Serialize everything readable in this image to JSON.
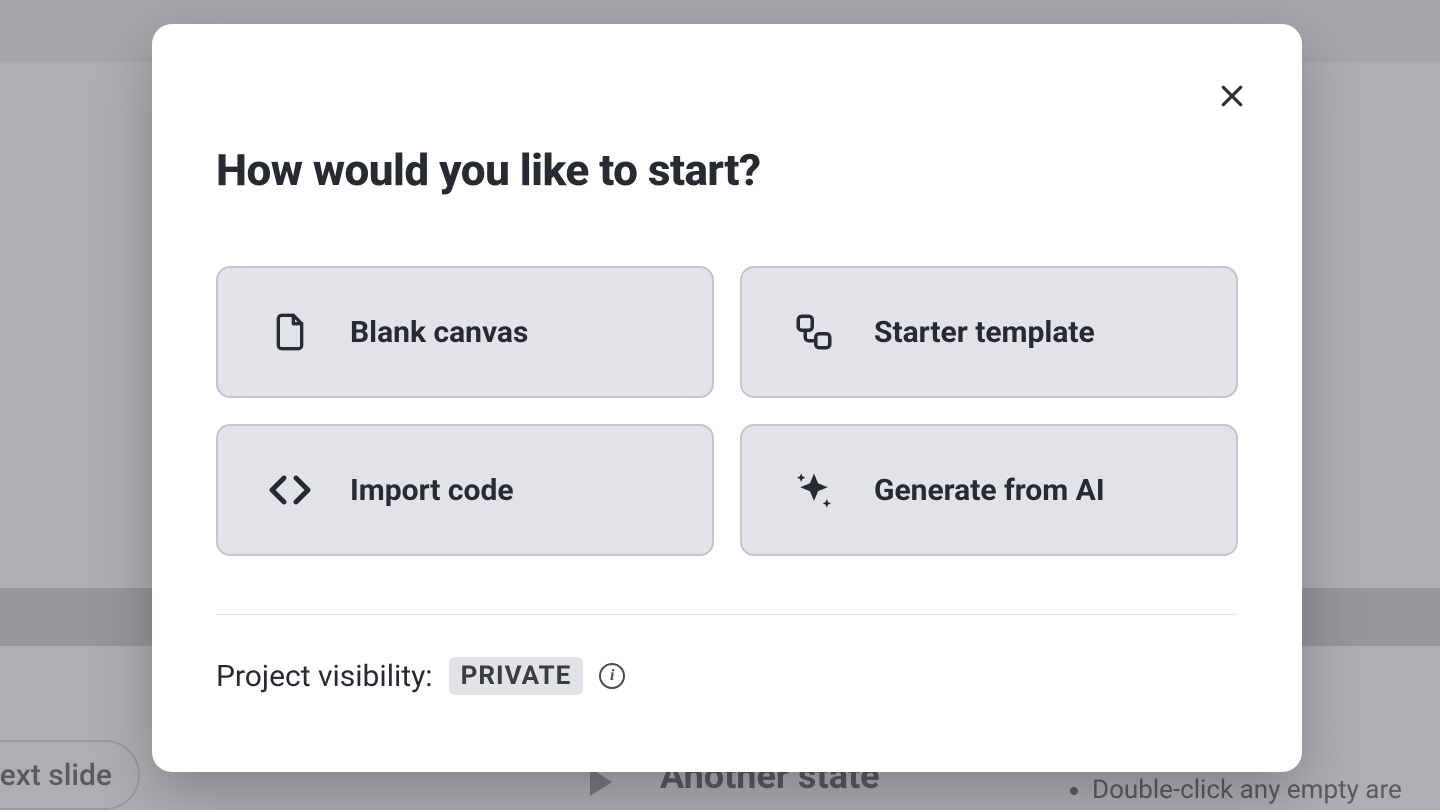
{
  "background": {
    "partial_pill_label": "ext slide",
    "partial_heading": "Another state",
    "hint_text": "Double-click any empty are"
  },
  "modal": {
    "title": "How would you like to start?",
    "options": [
      {
        "label": "Blank canvas"
      },
      {
        "label": "Starter template"
      },
      {
        "label": "Import code"
      },
      {
        "label": "Generate from AI"
      }
    ],
    "visibility": {
      "label": "Project visibility:",
      "value": "PRIVATE"
    }
  }
}
